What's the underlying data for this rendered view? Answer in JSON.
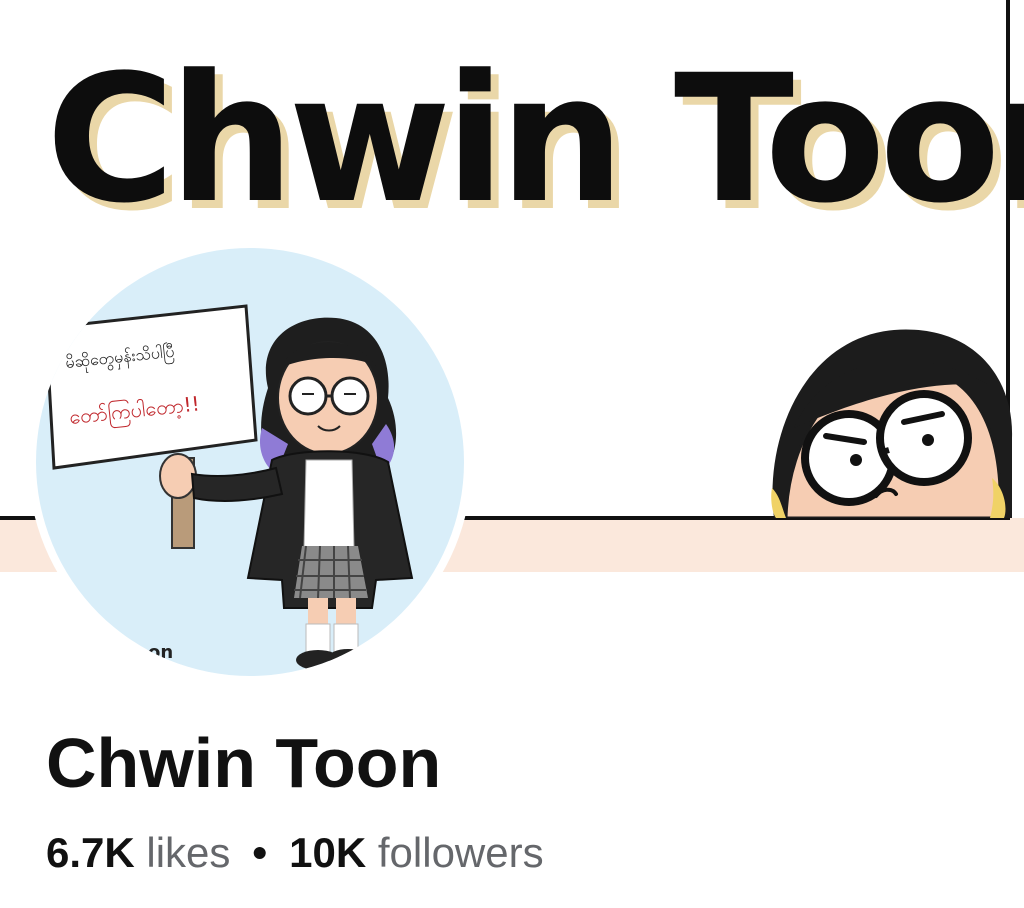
{
  "cover": {
    "title": "Chwin Toon"
  },
  "avatar": {
    "sign_line1": "မိဆိုတွေမှန်းသိပါပြီ",
    "sign_line2": "တော်ကြပါတော့!!",
    "watermark": "on"
  },
  "profile": {
    "name": "Chwin Toon",
    "likes_count": "6.7K",
    "likes_label": "likes",
    "separator": "•",
    "followers_count": "10K",
    "followers_label": "followers"
  },
  "colors": {
    "title_shadow": "#ead7a8",
    "cover_strip": "#fbe8dc",
    "avatar_bg": "#d9eef9",
    "sign_red": "#c0282d"
  }
}
